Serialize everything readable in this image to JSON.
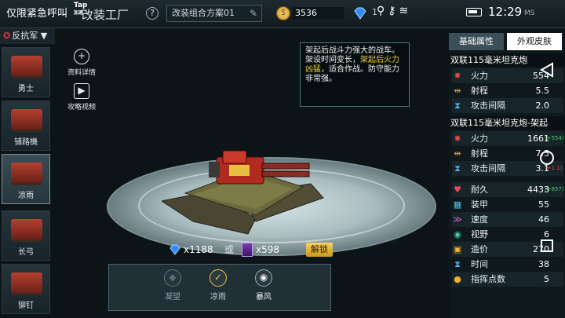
{
  "status": {
    "notification": "仅限紧急呼叫",
    "tap_brand": "Tap",
    "tap_sub": "加速",
    "clock": "12:29",
    "sms": "MS"
  },
  "header": {
    "title": "改装工厂",
    "help": "?",
    "scheme_name": "改装组合方案01",
    "coins": "3536",
    "diamonds": "1"
  },
  "faction": {
    "label": "反抗军"
  },
  "sidebar": {
    "units": [
      {
        "label": "勇士",
        "active": false
      },
      {
        "label": "铺路機",
        "active": false
      },
      {
        "label": "凉雨",
        "active": true
      },
      {
        "label": "长弓",
        "active": false
      },
      {
        "label": "铆钉",
        "active": false
      }
    ]
  },
  "tools": {
    "details": "资料详情",
    "video": "攻略视频"
  },
  "tooltip": {
    "part1": "架起后战斗力强大的战车。架设时间变长，",
    "highlight": "架起后火力凶猛",
    "part2": "，适合作战。防守能力非常强。"
  },
  "price": {
    "diamonds": "x1188",
    "or": "或",
    "cards": "x598",
    "unlock": "解锁"
  },
  "camo": [
    {
      "label": "凝望",
      "state": "dim"
    },
    {
      "label": "凉雨",
      "state": "checked"
    },
    {
      "label": "暴风",
      "state": "normal"
    }
  ],
  "panel": {
    "tab_attributes": "基础属性",
    "tab_skins": "外观皮肤",
    "section1": "双联115毫米坦克炮",
    "stats1": [
      {
        "label": "火力",
        "value": "554",
        "bonus": ""
      },
      {
        "label": "射程",
        "value": "5.5",
        "bonus": ""
      },
      {
        "label": "攻击间隔",
        "value": "2.0",
        "bonus": ""
      }
    ],
    "section2": "双联115毫米坦克炮-架起",
    "stats2": [
      {
        "label": "火力",
        "value": "1661",
        "bonus": "(+554)"
      },
      {
        "label": "射程",
        "value": "7.5",
        "bonus": ""
      },
      {
        "label": "攻击间隔",
        "value": "3.1",
        "bonus": "(+1.1)"
      }
    ],
    "stats3": [
      {
        "label": "耐久",
        "value": "4433",
        "bonus": "(+857)"
      },
      {
        "label": "装甲",
        "value": "55",
        "bonus": ""
      },
      {
        "label": "速度",
        "value": "46",
        "bonus": ""
      },
      {
        "label": "视野",
        "value": "6",
        "bonus": ""
      },
      {
        "label": "造价",
        "value": "270",
        "bonus": ""
      },
      {
        "label": "时间",
        "value": "38",
        "bonus": ""
      },
      {
        "label": "指挥点数",
        "value": "5",
        "bonus": ""
      }
    ]
  }
}
